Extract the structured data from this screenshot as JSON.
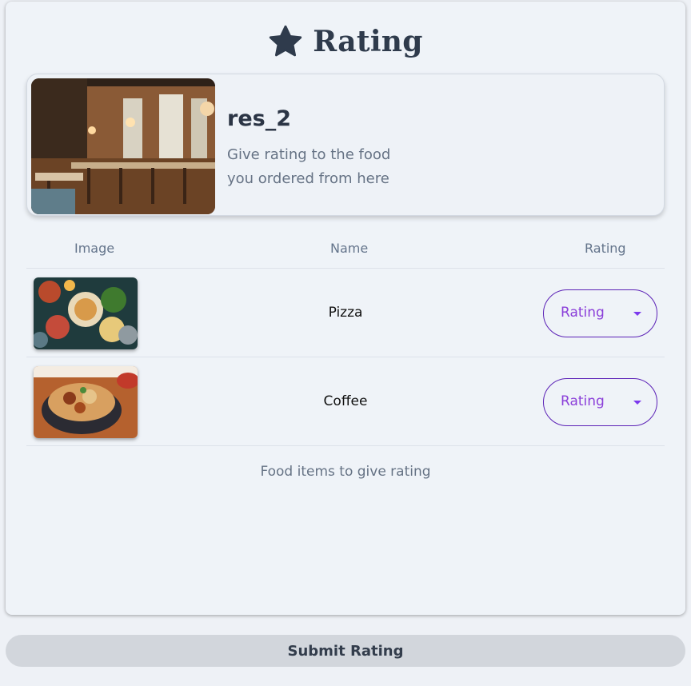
{
  "header": {
    "title": "Rating",
    "icon": "star-icon"
  },
  "restaurant": {
    "name": "res_2",
    "description_line1": "Give rating to the food",
    "description_line2": "you ordered from here",
    "photo": "restaurant-interior-photo"
  },
  "table": {
    "columns": [
      "Image",
      "Name",
      "Rating"
    ],
    "rows": [
      {
        "name": "Pizza",
        "image": "food-platter-photo",
        "rating_placeholder": "Rating"
      },
      {
        "name": "Coffee",
        "image": "noodle-bowl-photo",
        "rating_placeholder": "Rating"
      }
    ],
    "caption": "Food items to give rating"
  },
  "actions": {
    "submit_label": "Submit Rating"
  },
  "colors": {
    "accent": "#7c3aed",
    "text": "#2f3b4c",
    "submit_bg": "#d2d6dc"
  }
}
